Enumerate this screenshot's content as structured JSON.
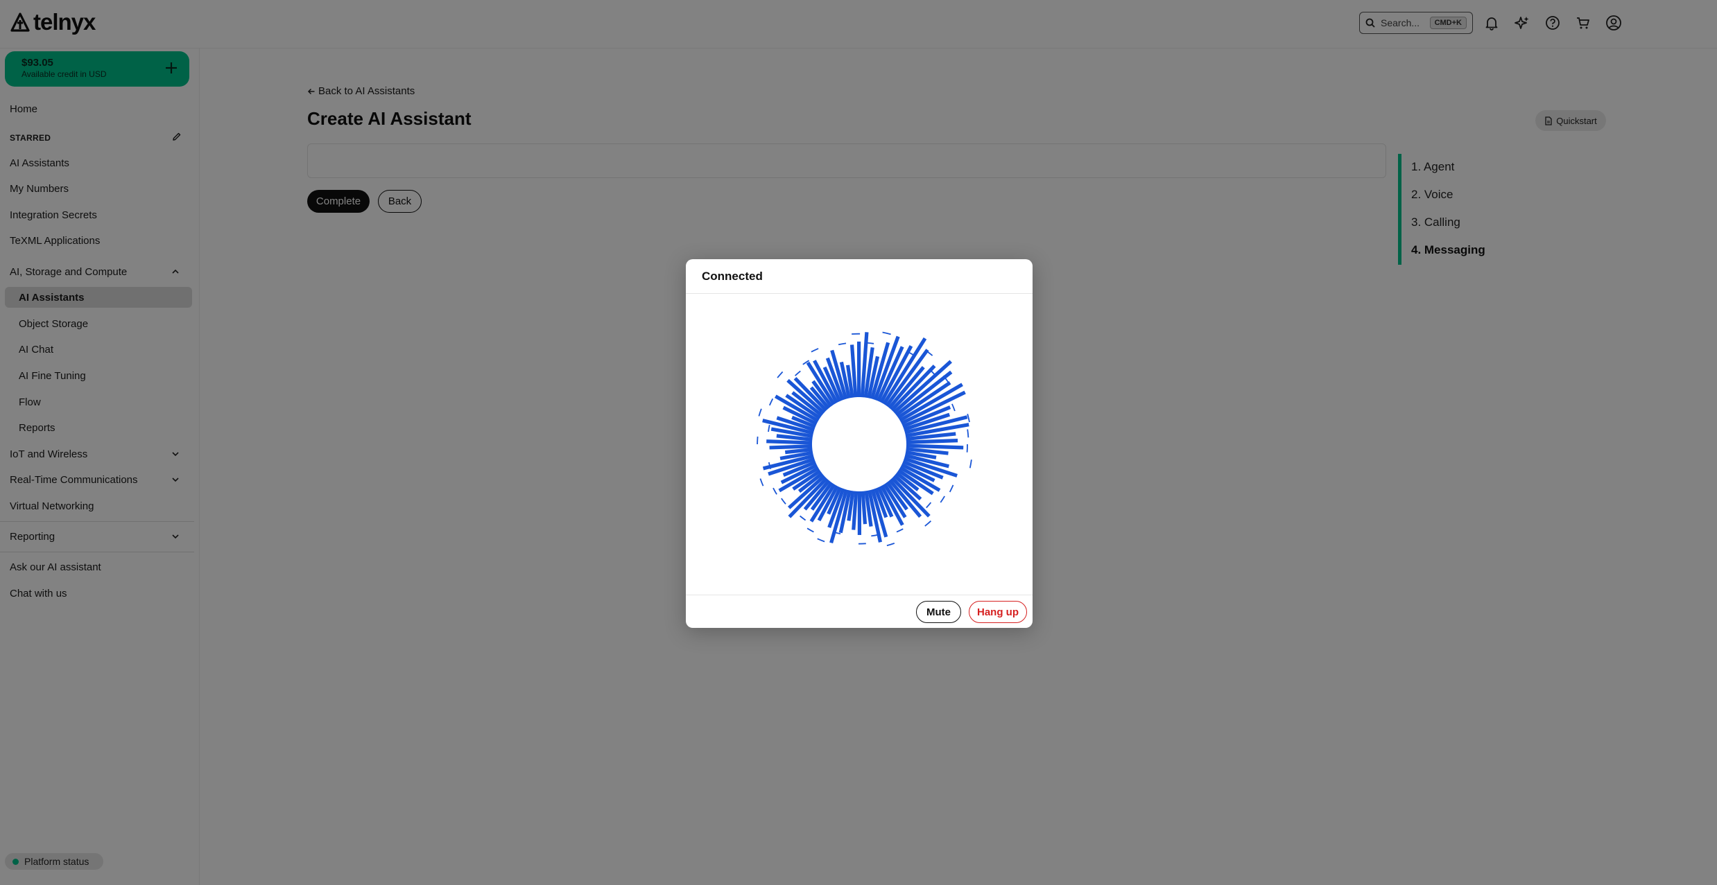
{
  "brand": {
    "name": "telnyx",
    "accent": "#00c08b"
  },
  "search": {
    "placeholder": "Search...",
    "shortcut": "CMD+K"
  },
  "header_icons": [
    "bell-icon",
    "sparkles-icon",
    "help-icon",
    "cart-icon",
    "user-icon"
  ],
  "credit": {
    "amount": "$93.05",
    "label": "Available credit in USD"
  },
  "sidebar": {
    "home": "Home",
    "starred_label": "STARRED",
    "starred": [
      "AI Assistants",
      "My Numbers",
      "Integration Secrets",
      "TeXML Applications"
    ],
    "ai_group": "AI, Storage and Compute",
    "ai_items": [
      "AI Assistants",
      "Object Storage",
      "AI Chat",
      "AI Fine Tuning",
      "Flow",
      "Reports"
    ],
    "iot": "IoT and Wireless",
    "rtc": "Real-Time Communications",
    "vnet": "Virtual Networking",
    "reporting": "Reporting",
    "ask_ai": "Ask our AI assistant",
    "chat": "Chat with us",
    "platform_status": "Platform status"
  },
  "main": {
    "back_link": "Back to AI Assistants",
    "title": "Create AI Assistant",
    "quickstart": "Quickstart",
    "complete": "Complete",
    "back": "Back",
    "steps": [
      "1. Agent",
      "2. Voice",
      "3. Calling",
      "4. Messaging"
    ],
    "current_step": 4
  },
  "modal": {
    "title": "Connected",
    "mute": "Mute",
    "hangup": "Hang up",
    "colors": {
      "inner": "#19e3b0",
      "outer": "#1a56d6",
      "danger": "#d62020"
    }
  }
}
